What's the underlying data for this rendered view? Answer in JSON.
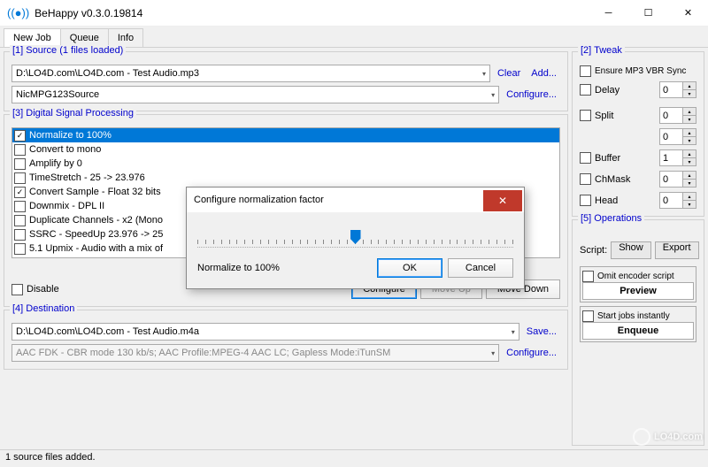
{
  "window": {
    "title": "BeHappy v0.3.0.19814"
  },
  "tabs": {
    "new_job": "New Job",
    "queue": "Queue",
    "info": "Info"
  },
  "source": {
    "title": "[1] Source  (1 files loaded)",
    "file": "D:\\LO4D.com\\LO4D.com - Test Audio.mp3",
    "decoder": "NicMPG123Source",
    "clear": "Clear",
    "add": "Add...",
    "configure": "Configure..."
  },
  "dsp": {
    "title": "[3] Digital Signal Processing",
    "items": [
      {
        "label": "Normalize to 100%",
        "checked": true,
        "selected": true
      },
      {
        "label": "Convert to mono",
        "checked": false
      },
      {
        "label": "Amplify by 0",
        "checked": false
      },
      {
        "label": "TimeStretch - 25 -> 23.976",
        "checked": false
      },
      {
        "label": "Convert Sample - Float 32 bits",
        "checked": true
      },
      {
        "label": "Downmix - DPL II",
        "checked": false
      },
      {
        "label": "Duplicate Channels - x2 (Mono",
        "checked": false
      },
      {
        "label": "SSRC - SpeedUp 23.976 -> 25",
        "checked": false
      },
      {
        "label": "5.1 Upmix - Audio with a mix of",
        "checked": false
      }
    ],
    "disable": "Disable",
    "configure": "Configure",
    "move_up": "Move Up",
    "move_down": "Move Down"
  },
  "dest": {
    "title": "[4] Destination",
    "file": "D:\\LO4D.com\\LO4D.com - Test Audio.m4a",
    "encoder": "AAC FDK - CBR mode 130 kb/s; AAC Profile:MPEG-4 AAC LC; Gapless Mode:iTunSM",
    "save": "Save...",
    "configure": "Configure..."
  },
  "tweak": {
    "title": "[2] Tweak",
    "ensure": "Ensure MP3 VBR Sync",
    "delay": "Delay",
    "delay_v": "0",
    "split": "Split",
    "split_v1": "0",
    "split_v2": "0",
    "buffer": "Buffer",
    "buffer_v": "1",
    "chmask": "ChMask",
    "chmask_v": "0",
    "head": "Head",
    "head_v": "0"
  },
  "ops": {
    "title": "[5] Operations",
    "script": "Script:",
    "show": "Show",
    "export": "Export",
    "omit": "Omit encoder script",
    "preview": "Preview",
    "start": "Start jobs instantly",
    "enqueue": "Enqueue"
  },
  "status": "1 source files added.",
  "dialog": {
    "title": "Configure normalization factor",
    "label": "Normalize to 100%",
    "ok": "OK",
    "cancel": "Cancel"
  },
  "watermark": "LO4D.com"
}
